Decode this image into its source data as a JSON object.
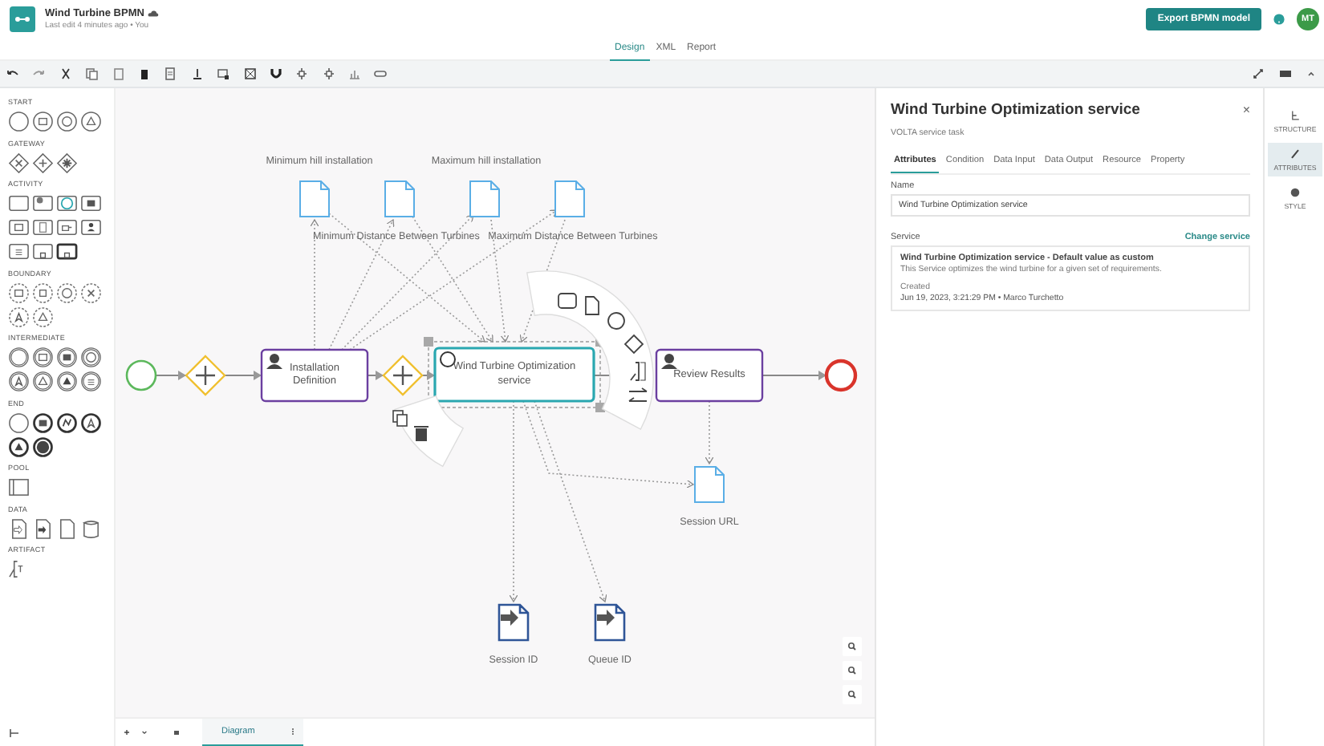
{
  "header": {
    "title": "Wind Turbine BPMN",
    "subtitle": "Last edit 4 minutes ago • You",
    "export_button": "Export BPMN model",
    "avatar": "MT"
  },
  "view_tabs": [
    {
      "label": "Design",
      "selected": true
    },
    {
      "label": "XML",
      "selected": false
    },
    {
      "label": "Report",
      "selected": false
    }
  ],
  "palette": [
    {
      "title": "START",
      "items": [
        {
          "kind": "event-none"
        },
        {
          "kind": "event-message"
        },
        {
          "kind": "event-timer"
        },
        {
          "kind": "event-signal"
        }
      ]
    },
    {
      "title": "GATEWAY",
      "items": [
        {
          "kind": "gateway-x"
        },
        {
          "kind": "gateway-plus"
        },
        {
          "kind": "gateway-star"
        }
      ]
    },
    {
      "title": "ACTIVITY",
      "items": [
        {
          "kind": "task-none"
        },
        {
          "kind": "task-gear"
        },
        {
          "kind": "task-ring"
        },
        {
          "kind": "task-envelopefilled"
        },
        {
          "kind": "task-message"
        },
        {
          "kind": "task-script"
        },
        {
          "kind": "task-hand"
        },
        {
          "kind": "task-user"
        },
        {
          "kind": "task-lines"
        },
        {
          "kind": "task-sub"
        },
        {
          "kind": "thicktask-sub"
        }
      ]
    },
    {
      "title": "BOUNDARY",
      "items": [
        {
          "kind": "boundary-message"
        },
        {
          "kind": "boundary-square"
        },
        {
          "kind": "boundary-timer"
        },
        {
          "kind": "boundary-x"
        },
        {
          "kind": "boundary-caret"
        },
        {
          "kind": "boundary-signal"
        }
      ]
    },
    {
      "title": "INTERMEDIATE",
      "items": [
        {
          "kind": "intermediate-none"
        },
        {
          "kind": "intermediate-message"
        },
        {
          "kind": "intermediate-envelopefilled"
        },
        {
          "kind": "intermediate-timer"
        },
        {
          "kind": "intermediate-caret"
        },
        {
          "kind": "intermediate-signal"
        },
        {
          "kind": "intermediate-signalfilled"
        },
        {
          "kind": "intermediate-lines"
        }
      ]
    },
    {
      "title": "END",
      "items": [
        {
          "kind": "event-none"
        },
        {
          "kind": "end-envelopefilled"
        },
        {
          "kind": "end-zigzag"
        },
        {
          "kind": "end-caret"
        },
        {
          "kind": "end-signalfilled"
        },
        {
          "kind": "end-terminate"
        }
      ]
    },
    {
      "title": "POOL",
      "items": [
        {
          "kind": "pool-none"
        }
      ]
    },
    {
      "title": "DATA",
      "items": [
        {
          "kind": "data-arrow"
        },
        {
          "kind": "data-arrowfilled"
        },
        {
          "kind": "data-none"
        },
        {
          "kind": "store-none"
        }
      ]
    },
    {
      "title": "ARTIFACT",
      "items": [
        {
          "kind": "annotation-none"
        }
      ]
    }
  ],
  "diagram": {
    "nodes": [
      {
        "kind": "start",
        "selected": false
      },
      {
        "kind": "gateway",
        "selected": false
      },
      {
        "kind": "user-task",
        "label": "Installation Definition",
        "selected": false
      },
      {
        "kind": "gateway",
        "selected": false
      },
      {
        "kind": "service-task",
        "label": "Wind Turbine Optimization service",
        "selected": true
      },
      {
        "kind": "user-task",
        "label": "Review Results",
        "selected": false
      },
      {
        "kind": "end",
        "selected": false
      }
    ],
    "data_objects": [
      {
        "kind": "data",
        "label": "Minimum hill installation"
      },
      {
        "kind": "data",
        "label": "Minimum Distance Between Turbines"
      },
      {
        "kind": "data",
        "label": "Maximum hill installation"
      },
      {
        "kind": "data",
        "label": "Maximum Distance Between Turbines"
      },
      {
        "kind": "data",
        "label": "Session URL"
      },
      {
        "kind": "output",
        "label": "Session ID"
      },
      {
        "kind": "output",
        "label": "Queue ID"
      }
    ]
  },
  "sheet_tabs": [
    {
      "label": "Diagram",
      "selected": true
    }
  ],
  "panel": {
    "title": "Wind Turbine Optimization service",
    "subtitle": "VOLTA service task",
    "close": "×",
    "tabs": [
      {
        "label": "Attributes",
        "selected": true
      },
      {
        "label": "Condition",
        "selected": false
      },
      {
        "label": "Data Input",
        "selected": false
      },
      {
        "label": "Data Output",
        "selected": false
      },
      {
        "label": "Resource",
        "selected": false
      },
      {
        "label": "Property",
        "selected": false
      }
    ],
    "name_label": "Name",
    "name_value": "Wind Turbine Optimization service",
    "service_label": "Service",
    "service_link": "Change service",
    "service_card": {
      "title": "Wind Turbine Optimization service - Default value as custom",
      "description": "This Service optimizes the wind turbine for a given set of requirements.",
      "created_label": "Created",
      "created_value": "Jun 19, 2023, 3:21:29 PM • Marco Turchetto"
    }
  },
  "rail": [
    {
      "label": "STRUCTURE",
      "selected": false
    },
    {
      "label": "ATTRIBUTES",
      "selected": true
    },
    {
      "label": "STYLE",
      "selected": false
    }
  ]
}
